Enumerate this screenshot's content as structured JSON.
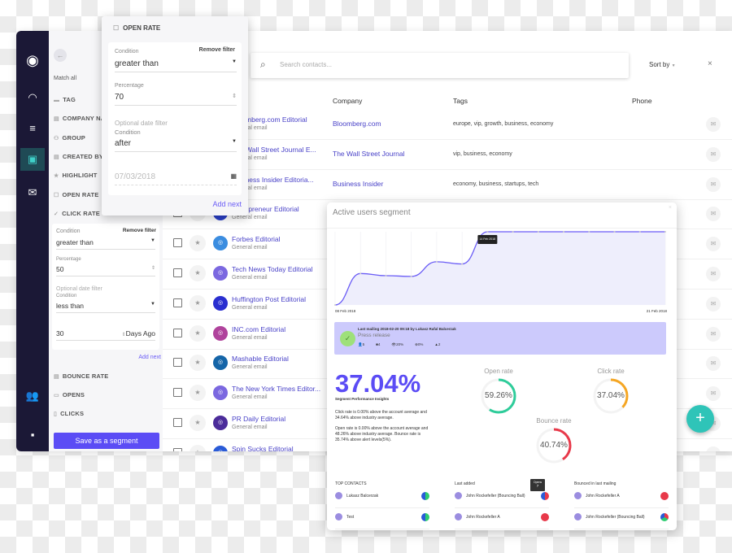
{
  "filters": {
    "match_all": "Match all",
    "items": [
      "TAG",
      "COMPANY NAME",
      "GROUP",
      "CREATED BY",
      "HIGHLIGHT",
      "OPEN RATE",
      "CLICK RATE"
    ],
    "items_after": [
      "BOUNCE RATE",
      "OPENS",
      "CLICKS"
    ],
    "click_rate": {
      "condition_label": "Condition",
      "remove": "Remove filter",
      "condition": "greater than",
      "percentage_label": "Percentage",
      "percentage": "50",
      "date_label": "Optional date filter",
      "date_condition_label": "Condition",
      "date_condition": "less than",
      "days": "30",
      "days_unit": "Days Ago"
    },
    "add_next": "Add next",
    "save": "Save as a segment"
  },
  "open_rate_popup": {
    "title": "OPEN RATE",
    "condition_label": "Condition",
    "remove": "Remove filter",
    "condition": "greater than",
    "percentage_label": "Percentage",
    "percentage": "70",
    "date_label": "Optional date filter",
    "date_condition_label": "Condition",
    "date_condition": "after",
    "date_placeholder": "07/03/2018",
    "add_next": "Add next"
  },
  "search": {
    "placeholder": "Search contacts...",
    "sort": "Sort by",
    "close": "×"
  },
  "table": {
    "headers": {
      "company": "Company",
      "tags": "Tags",
      "phone": "Phone"
    },
    "rows": [
      {
        "name": "Bloomberg.com Editorial",
        "sub": "General email",
        "company": "Bloomberg.com",
        "tags": "europe,  vip,  growth,  business,  economy",
        "color": "#2a5bd7"
      },
      {
        "name": "The Wall Street Journal E...",
        "sub": "General email",
        "company": "The Wall Street Journal",
        "tags": "vip,  business,  economy",
        "color": "#2a5bd7"
      },
      {
        "name": "Business Insider Editoria...",
        "sub": "General email",
        "company": "Business Insider",
        "tags": "economy,  business,  startups,  tech",
        "color": "#2a5bd7"
      },
      {
        "name": "Entrepreneur Editorial",
        "sub": "General email",
        "company": "",
        "tags": "",
        "color": "#2a3fc8"
      },
      {
        "name": "Forbes Editorial",
        "sub": "General email",
        "company": "",
        "tags": "",
        "color": "#3b8de0"
      },
      {
        "name": "Tech News Today Editorial",
        "sub": "General email",
        "company": "",
        "tags": "",
        "color": "#7b68e0"
      },
      {
        "name": "Huffington Post Editorial",
        "sub": "General email",
        "company": "",
        "tags": "",
        "color": "#2a2fd0"
      },
      {
        "name": "INC.com Editorial",
        "sub": "General email",
        "company": "",
        "tags": "",
        "color": "#b0439c"
      },
      {
        "name": "Mashable Editorial",
        "sub": "General email",
        "company": "",
        "tags": "",
        "color": "#1565a8"
      },
      {
        "name": "The New York Times Editor...",
        "sub": "General email",
        "company": "",
        "tags": "",
        "color": "#7b68e0"
      },
      {
        "name": "PR Daily Editorial",
        "sub": "General email",
        "company": "",
        "tags": "",
        "color": "#4b2c9a"
      },
      {
        "name": "Spin Sucks Editorial",
        "sub": "",
        "company": "",
        "tags": "",
        "color": "#2a5bd7"
      }
    ]
  },
  "segment": {
    "title": "Active users segment",
    "chart_data": {
      "type": "area",
      "x": [
        "08 Feb 2018",
        "09 Feb 2018",
        "10 Feb 2018",
        "11 Feb 2018",
        "12 Feb 2018",
        "13 Feb 2018",
        "14 Feb 2018",
        "15 Feb 2018",
        "16 Feb 2018",
        "17 Feb 2018",
        "18 Feb 2018",
        "19 Feb 2018",
        "20 Feb 2018",
        "21 Feb 2018"
      ],
      "values": [
        0,
        4.3,
        4.0,
        3.9,
        5.9,
        5.6,
        10,
        10,
        10,
        10,
        10,
        10,
        10,
        10
      ],
      "x_tick_labels": [
        "08 Feb 2018",
        "21 Feb 2018"
      ],
      "tooltip": "14 Feb 2018",
      "color": "#6a5cf6"
    },
    "mailing": {
      "line": "Last mailing 2018-02-20 09:18 by Lukasz Rafal Balcerzak",
      "title": "Press release",
      "stats": [
        "5",
        "4",
        "20%",
        "0%",
        "2"
      ]
    },
    "big_value": "37.04%",
    "insights_title": "Segment Performance Insights",
    "insight1": "Click rate is 0.00% above the account average and 34.64% above industry average.",
    "insight2": "Open rate is 0.00% above the account average and 48.26% above industry average. Bounce rate is 35.74% above alert levels(5%).",
    "rates": [
      {
        "label": "Open rate",
        "value": "59.26%",
        "fraction": 0.5926,
        "color": "#2ecc9a"
      },
      {
        "label": "Click rate",
        "value": "37.04%",
        "fraction": 0.3704,
        "color": "#f5a623"
      },
      {
        "label": "Bounce rate",
        "value": "40.74%",
        "fraction": 0.4074,
        "color": "#e8394a"
      }
    ],
    "lists": {
      "top": {
        "title": "TOP CONTACTS",
        "items": [
          "Lukasz Balcerzak",
          "Test"
        ]
      },
      "last": {
        "title": "Last added",
        "items": [
          "John Rockefeller (Bouncing Ball)",
          "John Rockefeller A"
        ]
      },
      "bounced": {
        "title": "Bounced in last mailing",
        "items": [
          "John Rockefeller A",
          "John Rockefeller (Bouncing Ball)"
        ]
      }
    },
    "pie_tooltip": {
      "label": "Opens",
      "value": "7"
    }
  },
  "fab": "+"
}
